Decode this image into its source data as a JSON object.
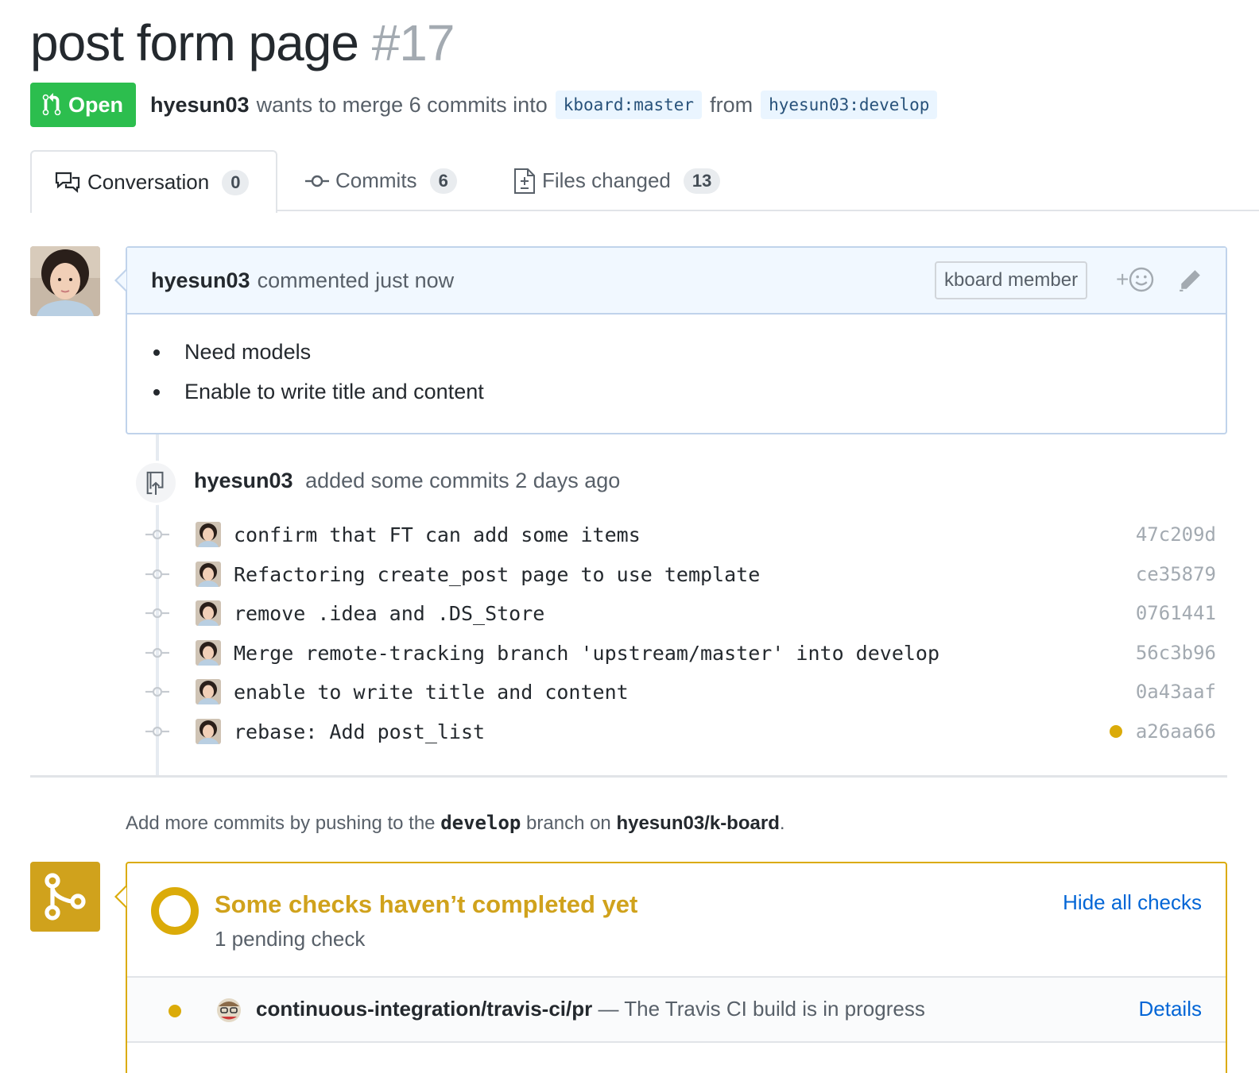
{
  "pr": {
    "title": "post form page",
    "number": "#17",
    "state": "Open",
    "author": "hyesun03",
    "merge_text_1": "wants to merge 6 commits into",
    "base_branch": "kboard:master",
    "merge_text_2": "from",
    "head_branch": "hyesun03:develop"
  },
  "tabs": [
    {
      "label": "Conversation",
      "count": "0",
      "icon": "comment-discussion-icon"
    },
    {
      "label": "Commits",
      "count": "6",
      "icon": "git-commit-icon"
    },
    {
      "label": "Files changed",
      "count": "13",
      "icon": "diff-icon"
    }
  ],
  "comment": {
    "author": "hyesun03",
    "meta": "commented just now",
    "role_label": "kboard member",
    "reaction_plus": "+",
    "body": [
      "Need models",
      "Enable to write title and content"
    ]
  },
  "push_event": {
    "author": "hyesun03",
    "text": "added some commits 2 days ago"
  },
  "commits": [
    {
      "message": "confirm that FT can add some items",
      "sha": "47c209d"
    },
    {
      "message": "Refactoring create_post page to use template",
      "sha": "ce35879"
    },
    {
      "message": "remove .idea and .DS_Store",
      "sha": "0761441"
    },
    {
      "message": "Merge remote-tracking branch 'upstream/master' into develop",
      "sha": "56c3b96"
    },
    {
      "message": "enable to write title and content",
      "sha": "0a43aaf"
    },
    {
      "message": "rebase: Add post_list",
      "sha": "a26aa66",
      "status": "pending"
    }
  ],
  "hint": {
    "prefix": "Add more commits by pushing to the",
    "branch": "develop",
    "middle": "branch on",
    "repo": "hyesun03/k-board",
    "suffix": "."
  },
  "checks": {
    "title": "Some checks haven’t completed yet",
    "subtitle": "1 pending check",
    "toggle_label": "Hide all checks",
    "items": [
      {
        "name": "continuous-integration/travis-ci/pr",
        "description": "— The Travis CI build is in progress",
        "link": "Details",
        "status": "pending"
      }
    ]
  },
  "colors": {
    "open_green": "#2cbe4e",
    "pending_yellow": "#dbab09",
    "link_blue": "#0366d6"
  }
}
